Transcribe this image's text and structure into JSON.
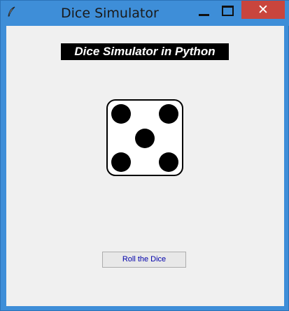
{
  "window": {
    "title": "Dice Simulator",
    "close_glyph": "✕"
  },
  "app": {
    "heading": "Dice Simulator in Python",
    "dice": {
      "value": 5,
      "symbol": "⚄"
    },
    "roll_button_label": "Roll the Dice"
  },
  "icons": {
    "app_icon": "feather-icon",
    "minimize": "minimize-icon",
    "maximize": "maximize-icon",
    "close": "close-icon"
  },
  "colors": {
    "titlebar": "#3e8ed8",
    "close_button": "#c9453d",
    "client_background": "#f0f0f0",
    "heading_background": "#000000",
    "heading_text": "#ffffff",
    "button_text": "#0000aa"
  }
}
